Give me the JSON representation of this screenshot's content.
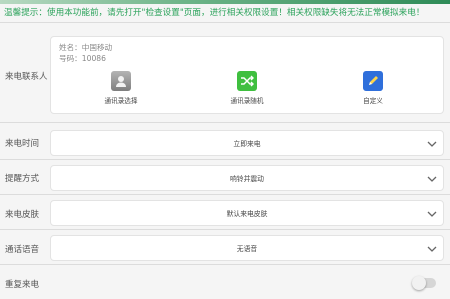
{
  "notice": {
    "text": "温馨提示：使用本功能前，请先打开\"检查设置\"页面，进行相关权限设置！相关权限缺失将无法正常模拟来电！"
  },
  "caller": {
    "label": "来电联系人",
    "name_line": "姓名：中国移动",
    "number_line": "号码：10086",
    "options": [
      {
        "label": "通讯录选择",
        "icon": "contacts-icon"
      },
      {
        "label": "通讯录随机",
        "icon": "shuffle-icon"
      },
      {
        "label": "自定义",
        "icon": "edit-icon"
      }
    ]
  },
  "settings": [
    {
      "label": "来电时间",
      "value": "立即来电"
    },
    {
      "label": "提醒方式",
      "value": "响铃并震动"
    },
    {
      "label": "来电皮肤",
      "value": "默认来电皮肤"
    },
    {
      "label": "通话语音",
      "value": "无语音"
    }
  ],
  "repeat": {
    "label": "重复来电",
    "enabled": false
  },
  "colors": {
    "accent": "#2aa25a",
    "contacts_icon": "#9b9b9b",
    "shuffle_icon": "#3fbf3f",
    "edit_icon": "#2f6fdb",
    "toggle_off": "#d6d6d6"
  }
}
